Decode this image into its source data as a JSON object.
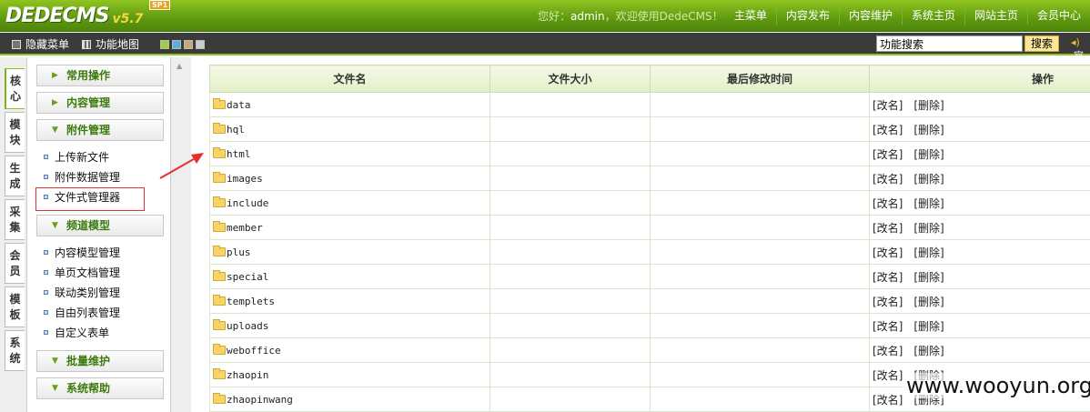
{
  "logo": {
    "name": "DEDECMS",
    "version": "v5.7",
    "badge": "SP1"
  },
  "welcome": {
    "prefix": "您好：",
    "user": "admin",
    "suffix": "，欢迎使用DedeCMS！"
  },
  "topnav": [
    "主菜单",
    "内容发布",
    "内容维护",
    "系统主页",
    "网站主页",
    "会员中心"
  ],
  "toolbar": {
    "hide_menu": "隐藏菜单",
    "func_map": "功能地图",
    "skin_colors": [
      "#9fcf3a",
      "#5ab0e0",
      "#c8a878",
      "#cccccc"
    ]
  },
  "search": {
    "value": "功能搜索",
    "button": "搜索"
  },
  "speaker_text": "官",
  "vtabs": [
    "核心",
    "模块",
    "生成",
    "采集",
    "会员",
    "模板",
    "系统"
  ],
  "menu": {
    "sections": [
      {
        "title": "常用操作",
        "expanded": false
      },
      {
        "title": "内容管理",
        "expanded": false
      },
      {
        "title": "附件管理",
        "expanded": true,
        "items": [
          "上传新文件",
          "附件数据管理",
          "文件式管理器"
        ]
      },
      {
        "title": "频道模型",
        "expanded": true,
        "items": [
          "内容模型管理",
          "单页文档管理",
          "联动类别管理",
          "自由列表管理",
          "自定义表单"
        ]
      },
      {
        "title": "批量维护",
        "expanded": false
      },
      {
        "title": "系统帮助",
        "expanded": false
      }
    ],
    "highlighted_item": "文件式管理器"
  },
  "table": {
    "headers": [
      "文件名",
      "文件大小",
      "最后修改时间",
      "操作"
    ],
    "rows": [
      {
        "name": "data"
      },
      {
        "name": "hql"
      },
      {
        "name": "html"
      },
      {
        "name": "images"
      },
      {
        "name": "include"
      },
      {
        "name": "member"
      },
      {
        "name": "plus"
      },
      {
        "name": "special"
      },
      {
        "name": "templets"
      },
      {
        "name": "uploads"
      },
      {
        "name": "weboffice"
      },
      {
        "name": "zhaopin"
      },
      {
        "name": "zhaopinwang"
      }
    ],
    "ops": [
      "[改名]",
      "[删除]"
    ]
  },
  "watermark": "www.wooyun.org"
}
